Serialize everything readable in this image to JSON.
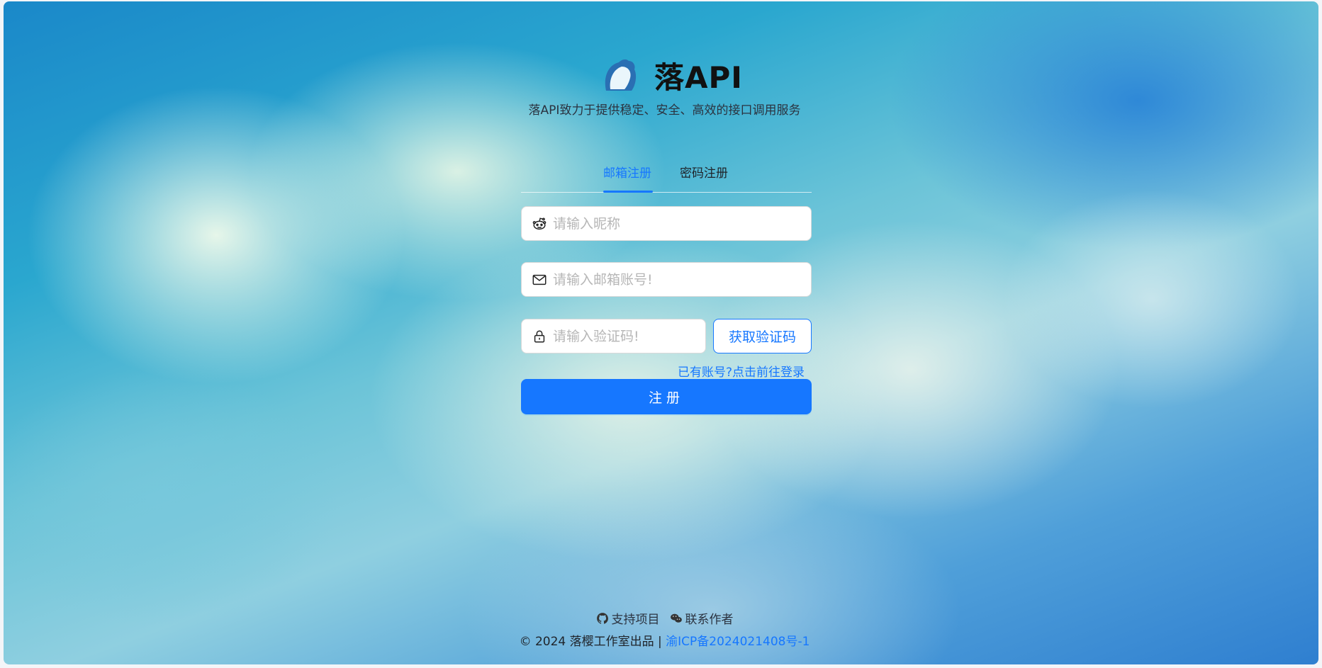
{
  "brand": {
    "title": "落API",
    "subtitle": "落API致力于提供稳定、安全、高效的接口调用服务"
  },
  "tabs": [
    {
      "label": "邮箱注册",
      "active": true
    },
    {
      "label": "密码注册",
      "active": false
    }
  ],
  "form": {
    "nickname_placeholder": "请输入昵称",
    "email_placeholder": "请输入邮箱账号!",
    "code_placeholder": "请输入验证码!",
    "get_code_label": "获取验证码",
    "login_link": "已有账号?点击前往登录",
    "submit_label": "注册"
  },
  "footer": {
    "support_label": "支持项目",
    "contact_label": "联系作者",
    "copyright_text": "© 2024 落樱工作室出品 | ",
    "icp_label": "渝ICP备2024021408号-1"
  },
  "colors": {
    "primary": "#1677ff",
    "text": "#1f2329"
  },
  "icons": [
    "logo-icon",
    "reddit-icon",
    "mail-icon",
    "lock-icon",
    "github-icon",
    "wechat-icon"
  ]
}
